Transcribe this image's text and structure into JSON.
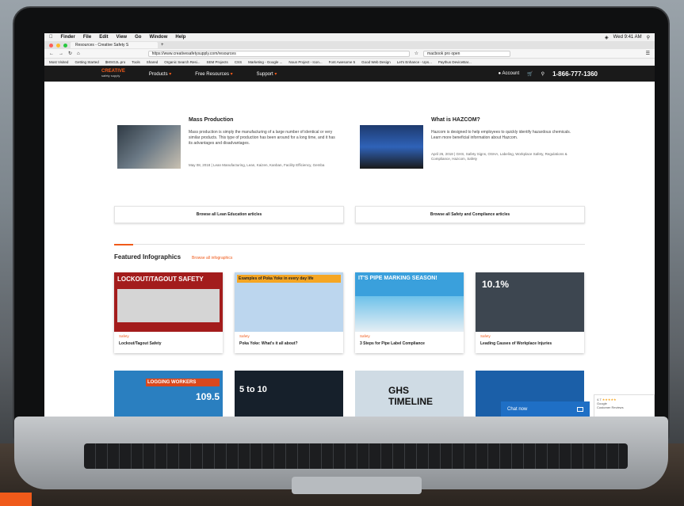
{
  "menubar": {
    "apple": "",
    "items": [
      "Finder",
      "File",
      "Edit",
      "View",
      "Go",
      "Window",
      "Help"
    ],
    "clock": "Wed 9:41 AM"
  },
  "browser": {
    "tab_title": "Resources - Creative Safety S",
    "url": "https://www.creativesafetysupply.com/resources",
    "search": "macbook pro open",
    "bookmarks": [
      "Most Visited",
      "Getting Started",
      "$MSG2L.pro",
      "Tools",
      "Shared",
      "Organic Search Resi...",
      "SEM Projects",
      "CSS",
      "Marketing - Google ...",
      "Noun Project - Icon...",
      "Font Awesome 5",
      "Good Web Design",
      "Let's Enhance - Ups...",
      "Paythus DeviceBar..."
    ]
  },
  "site": {
    "logo_line1": "CREATIVE",
    "logo_line2": "safety supply",
    "nav": [
      "Products",
      "Free Resources",
      "Support"
    ],
    "account": "Account",
    "phone": "1-866-777-1360"
  },
  "articles": [
    {
      "title": "Mass Production",
      "text": "Mass production is simply the manufacturing of a large number of identical or very similar products. This type of production has been around for a long time, and it has its advantages and disadvantages.",
      "meta": "May 08, 2018  |  Lean Manufacturing, Lean, Kaizen, Kanban, Facility Efficiency, Gemba"
    },
    {
      "title": "What is HAZCOM?",
      "text": "Hazcom is designed to help employees to quickly identify hazardous chemicals. Learn more beneficial information about Hazcom.",
      "meta": "April 26, 2018  |  GHS, Safety Signs, OSHA, Labeling, Workplace Safety, Regulations & Compliance, Hazcom, Safety"
    }
  ],
  "browse": [
    "Browse all Lean Education articles",
    "Browse all Safety and Compliance articles"
  ],
  "featured": {
    "title": "Featured Infographics",
    "link": "Browse all infographics"
  },
  "cards": [
    {
      "cat": "Safety",
      "title": "Lockout/Tagout Safety",
      "img_text": "LOCKOUT/TAGOUT SAFETY"
    },
    {
      "cat": "Safety",
      "title": "Poka Yoke: What's it all about?",
      "img_text": "Examples of Poka Yoke in every day life"
    },
    {
      "cat": "Safety",
      "title": "3 Steps for Pipe Label Compliance",
      "img_text": "IT'S PIPE MARKING SEASON!"
    },
    {
      "cat": "Safety",
      "title": "Leading Causes of Workplace Injuries",
      "img_text": "10.1%"
    }
  ],
  "row2": [
    {
      "img_text": "LOGGING WORKERS",
      "num": "109.5"
    },
    {
      "img_text": "5 to 10"
    },
    {
      "img_text": "GHS TIMELINE"
    },
    {
      "img_text": ""
    }
  ],
  "chat": "Chat now",
  "review": {
    "rating": "4.7",
    "stars": "★★★★★",
    "line1": "Google",
    "line2": "Customer Reviews"
  }
}
